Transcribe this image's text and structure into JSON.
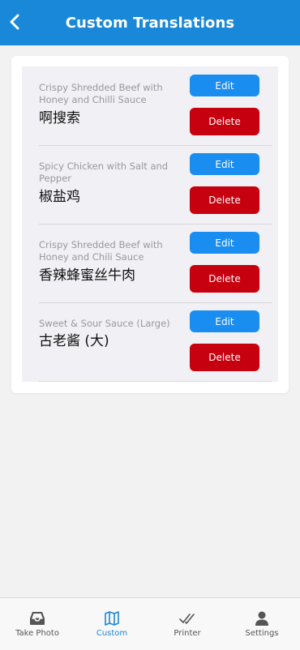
{
  "header": {
    "title": "Custom Translations",
    "back_icon": "chevron-left-icon"
  },
  "translations": [
    {
      "english": "Crispy Shredded Beef with Honey and Chilli Sauce",
      "chinese": "啊搜索",
      "edit_label": "Edit",
      "delete_label": "Delete"
    },
    {
      "english": "Spicy Chicken with Salt and Pepper",
      "chinese": "椒盐鸡",
      "edit_label": "Edit",
      "delete_label": "Delete"
    },
    {
      "english": "Crispy Shredded Beef with Honey and Chili Sauce",
      "chinese": "香辣蜂蜜丝牛肉",
      "edit_label": "Edit",
      "delete_label": "Delete"
    },
    {
      "english": "Sweet & Sour Sauce (Large)",
      "chinese": "古老酱 (大)",
      "edit_label": "Edit",
      "delete_label": "Delete"
    }
  ],
  "tabbar": {
    "tabs": [
      {
        "label": "Take Photo",
        "icon": "inbox-tray-icon",
        "active": false
      },
      {
        "label": "Custom",
        "icon": "map-icon",
        "active": true
      },
      {
        "label": "Printer",
        "icon": "double-check-icon",
        "active": false
      },
      {
        "label": "Settings",
        "icon": "user-icon",
        "active": false
      }
    ]
  },
  "colors": {
    "header_bg": "#1a88d8",
    "edit_button": "#1a8ef0",
    "delete_button": "#c7000f",
    "active_tab": "#1a88d8"
  }
}
